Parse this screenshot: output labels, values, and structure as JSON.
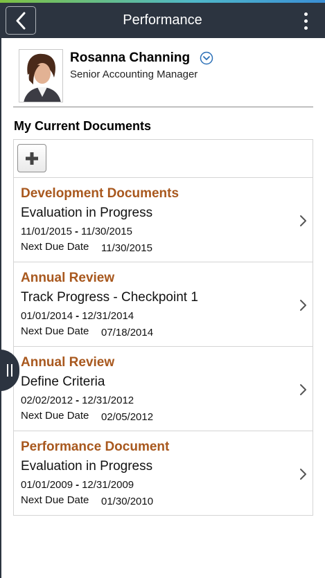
{
  "header": {
    "title": "Performance",
    "back_icon": "chevron-left-icon",
    "menu_icon": "kebab-menu-icon"
  },
  "profile": {
    "name": "Rosanna Channing",
    "job_title": "Senior Accounting Manager",
    "dropdown_icon": "chevron-down-circle-icon"
  },
  "section": {
    "title": "My Current Documents",
    "add_icon": "plus-icon"
  },
  "documents": [
    {
      "type": "Development Documents",
      "status": "Evaluation in Progress",
      "start": "11/01/2015",
      "sep": "-",
      "end": "11/30/2015",
      "due_label": "Next Due Date",
      "due_date": "11/30/2015"
    },
    {
      "type": "Annual Review",
      "status": "Track Progress - Checkpoint 1",
      "start": "01/01/2014",
      "sep": "-",
      "end": "12/31/2014",
      "due_label": "Next Due Date",
      "due_date": "07/18/2014"
    },
    {
      "type": "Annual Review",
      "status": "Define Criteria",
      "start": "02/02/2012",
      "sep": "-",
      "end": "12/31/2012",
      "due_label": "Next Due Date",
      "due_date": "02/05/2012"
    },
    {
      "type": "Performance Document",
      "status": "Evaluation in Progress",
      "start": "01/01/2009",
      "sep": "-",
      "end": "12/31/2009",
      "due_label": "Next Due Date",
      "due_date": "01/30/2010"
    }
  ],
  "colors": {
    "header_bg": "#2c3440",
    "doc_type": "#a8581e",
    "accent_blue": "#2a6fb7"
  }
}
